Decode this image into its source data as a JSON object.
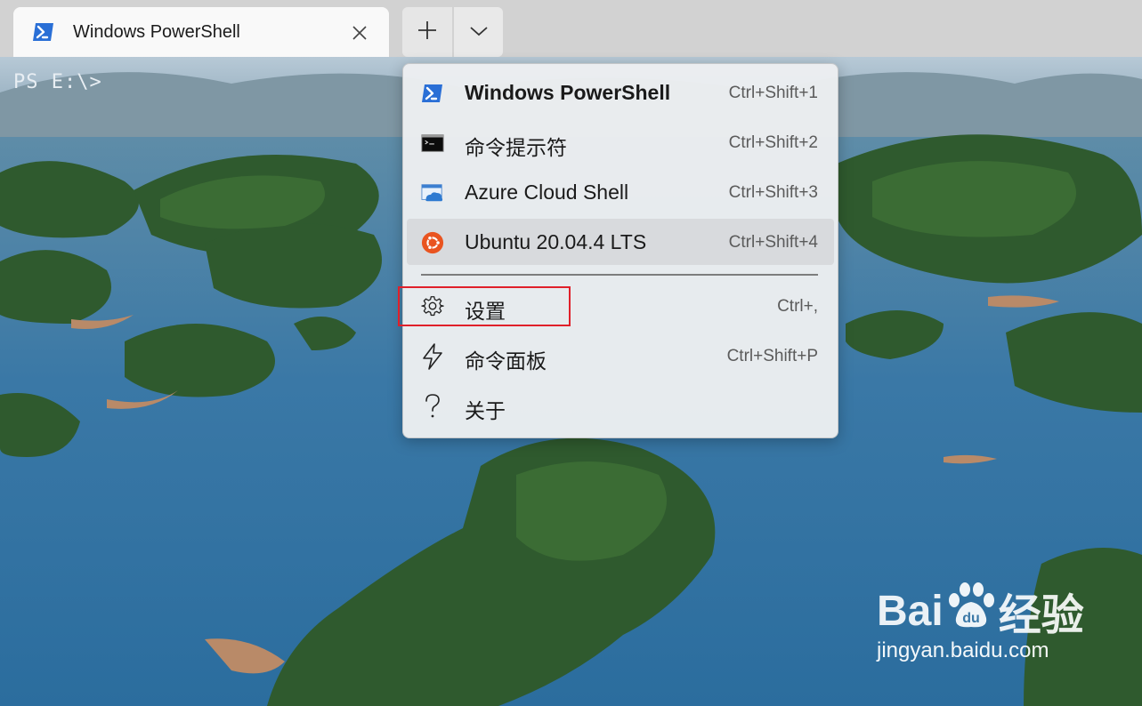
{
  "window": {
    "tab_title": "Windows PowerShell",
    "tab_icon": "powershell-icon",
    "new_tab_icon": "plus-icon",
    "dropdown_icon": "chevron-down-icon",
    "close_icon": "close-icon"
  },
  "terminal": {
    "prompt": "PS E:\\>"
  },
  "menu": {
    "items": [
      {
        "label": "Windows PowerShell",
        "shortcut": "Ctrl+Shift+1",
        "icon": "powershell-icon",
        "bold": true
      },
      {
        "label": "命令提示符",
        "shortcut": "Ctrl+Shift+2",
        "icon": "cmd-icon"
      },
      {
        "label": "Azure Cloud Shell",
        "shortcut": "Ctrl+Shift+3",
        "icon": "azure-cloud-shell-icon"
      },
      {
        "label": "Ubuntu 20.04.4 LTS",
        "shortcut": "Ctrl+Shift+4",
        "icon": "ubuntu-icon",
        "hovered": true
      },
      {
        "label": "设置",
        "shortcut": "Ctrl+,",
        "icon": "gear-icon",
        "highlighted": true
      },
      {
        "label": "命令面板",
        "shortcut": "Ctrl+Shift+P",
        "icon": "lightning-icon"
      },
      {
        "label": "关于",
        "shortcut": "",
        "icon": "question-icon"
      }
    ]
  },
  "watermark": {
    "logo_text_left": "Bai",
    "logo_text_right": "du",
    "logo_cn": "经验",
    "url": "jingyan.baidu.com"
  },
  "colors": {
    "highlight_border": "#e0202a",
    "powershell_blue": "#2a6fd6",
    "ubuntu_orange": "#e95420"
  }
}
